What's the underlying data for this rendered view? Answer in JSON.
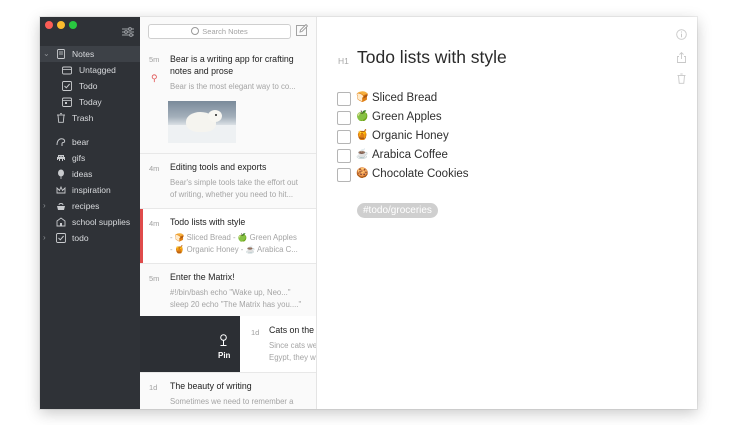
{
  "sidebar": {
    "items": [
      {
        "label": "Notes"
      },
      {
        "label": "Untagged"
      },
      {
        "label": "Todo"
      },
      {
        "label": "Today"
      },
      {
        "label": "Trash"
      },
      {
        "label": "bear"
      },
      {
        "label": "gifs"
      },
      {
        "label": "ideas"
      },
      {
        "label": "inspiration"
      },
      {
        "label": "recipes"
      },
      {
        "label": "school supplies"
      },
      {
        "label": "todo"
      }
    ]
  },
  "search": {
    "placeholder": "Search Notes"
  },
  "notes": [
    {
      "age": "5m",
      "title_l1": "Bear is a writing app for crafting",
      "title_l2": "notes and prose",
      "ex1": "Bear is the most elegant way to co..."
    },
    {
      "age": "4m",
      "title": "Editing tools and exports",
      "ex1": "Bear's simple tools take the effort out",
      "ex2": "of writing, whether you need to hit..."
    },
    {
      "age": "4m",
      "title": "Todo lists with style",
      "ex1": "- 🍞 Sliced Bread - 🍏 Green Apples",
      "ex2": "- 🍯 Organic Honey - ☕ Arabica C..."
    },
    {
      "age": "5m",
      "title": "Enter the Matrix!",
      "ex1": "#!/bin/bash echo \"Wake up, Neo...\"",
      "ex2": "sleep 20 echo \"The Matrix has you....\""
    },
    {
      "age": "1d",
      "title": "Cats on the",
      "ex1": "Since cats we",
      "ex2": "Egypt, they w"
    },
    {
      "age": "1d",
      "title": "The beauty of writing",
      "ex1": "Sometimes we need to remember a"
    }
  ],
  "pin_action": {
    "label": "Pin"
  },
  "editor": {
    "heading_marker": "H1",
    "title": "Todo lists with style",
    "todos": [
      {
        "emoji": "🍞",
        "text": "Sliced Bread"
      },
      {
        "emoji": "🍏",
        "text": "Green Apples"
      },
      {
        "emoji": "🍯",
        "text": "Organic Honey"
      },
      {
        "emoji": "☕",
        "text": "Arabica Coffee"
      },
      {
        "emoji": "🍪",
        "text": "Chocolate Cookies"
      }
    ],
    "tag": "#todo/groceries"
  },
  "colors": {
    "sidebar_bg": "#2f3237",
    "accent_red": "#df4b4b",
    "tag_bg": "#cfcfcf"
  }
}
